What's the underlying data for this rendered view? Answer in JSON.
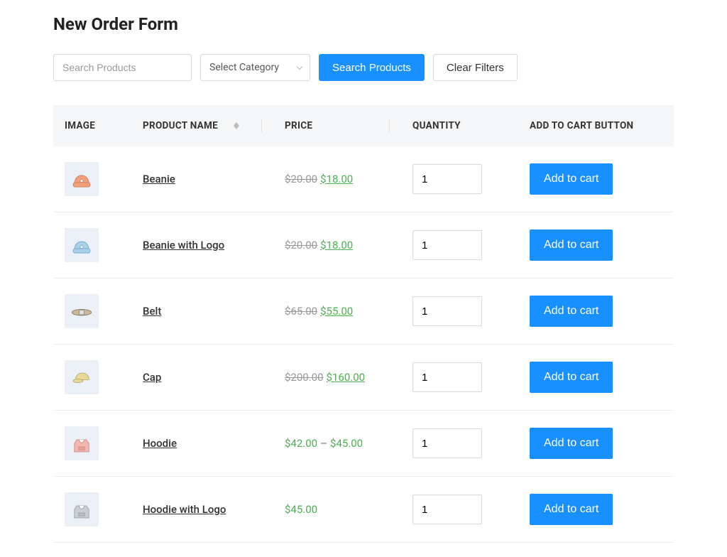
{
  "page": {
    "title": "New Order Form"
  },
  "filters": {
    "search_placeholder": "Search Products",
    "category_placeholder": "Select Category",
    "search_button": "Search Products",
    "clear_button": "Clear Filters"
  },
  "table": {
    "headers": {
      "image": "IMAGE",
      "product_name": "PRODUCT NAME",
      "price": "PRICE",
      "quantity": "QUANTITY",
      "add_to_cart": "ADD TO CART BUTTON"
    },
    "add_to_cart_label": "Add to cart",
    "rows": [
      {
        "name": "Beanie",
        "price_type": "sale",
        "old": "$20.00",
        "new": "$18.00",
        "qty": "1",
        "icon": "beanie-orange"
      },
      {
        "name": "Beanie with Logo",
        "price_type": "sale",
        "old": "$20.00",
        "new": "$18.00",
        "qty": "1",
        "icon": "beanie-blue"
      },
      {
        "name": "Belt",
        "price_type": "sale",
        "old": "$65.00",
        "new": "$55.00",
        "qty": "1",
        "icon": "belt"
      },
      {
        "name": "Cap",
        "price_type": "sale",
        "old": "$200.00",
        "new": "$160.00",
        "qty": "1",
        "icon": "cap"
      },
      {
        "name": "Hoodie",
        "price_type": "range",
        "low": "$42.00",
        "high": "$45.00",
        "qty": "1",
        "icon": "hoodie-pink"
      },
      {
        "name": "Hoodie with Logo",
        "price_type": "single",
        "val": "$45.00",
        "qty": "1",
        "icon": "hoodie-gray"
      }
    ]
  }
}
